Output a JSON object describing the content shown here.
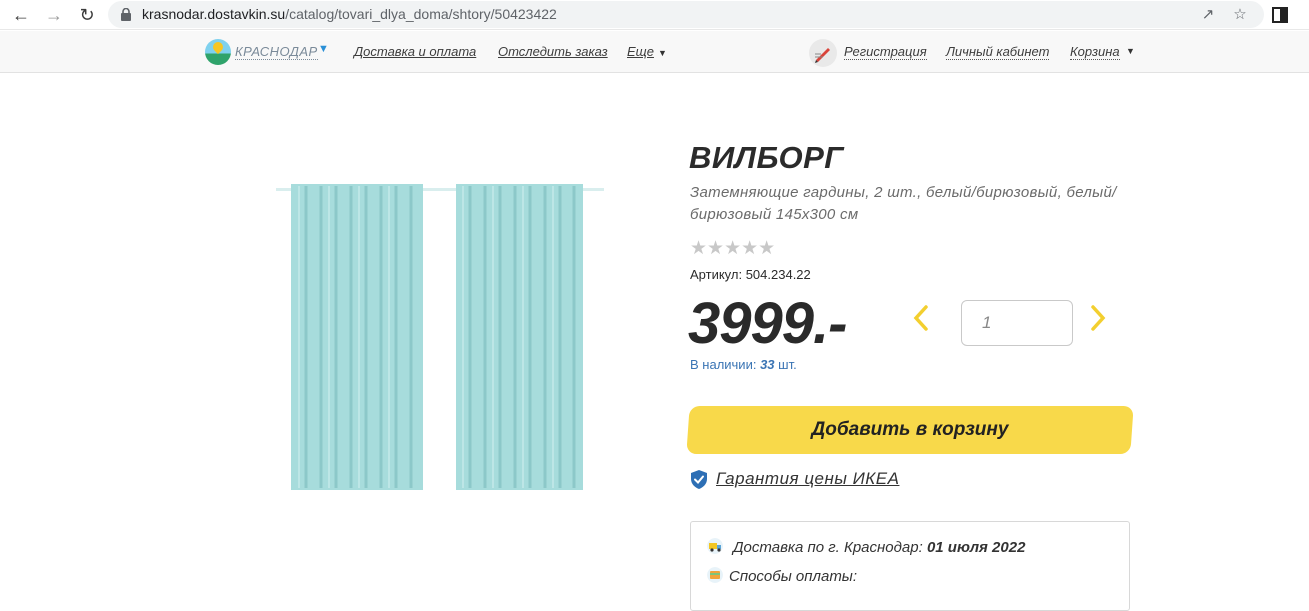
{
  "browser": {
    "url_host": "krasnodar.dostavkin.su",
    "url_path": "/catalog/tovari_dlya_doma/shtory/50423422"
  },
  "header": {
    "city": "КРАСНОДАР",
    "links": {
      "delivery": "Доставка и оплата",
      "track": "Отследить заказ",
      "more": "Еще",
      "register": "Регистрация",
      "account": "Личный кабинет",
      "cart": "Корзина"
    }
  },
  "product": {
    "title": "ВИЛБОРГ",
    "subtitle": "Затемняющие гардины, 2 шт., белый/бирюзовый, белый/бирюзовый 145x300 см",
    "rating": {
      "stars_display": "★★★★★",
      "value": 0,
      "max": 5
    },
    "sku_label": "Артикул:",
    "sku": "504.234.22",
    "price": "3999.-",
    "quantity": "1",
    "stock_label": "В наличии:",
    "stock_count": "33",
    "stock_unit": "шт.",
    "add_to_cart": "Добавить в корзину",
    "guarantee": "Гарантия цены ИКЕА",
    "curtain_color": "#a7dcdc"
  },
  "delivery": {
    "delivery_label": "Доставка по г. Краснодар:",
    "delivery_date": "01 июля 2022",
    "payment_label": "Способы оплаты:"
  },
  "colors": {
    "accent_yellow": "#f8d94a",
    "link_blue": "#3a74b4"
  }
}
